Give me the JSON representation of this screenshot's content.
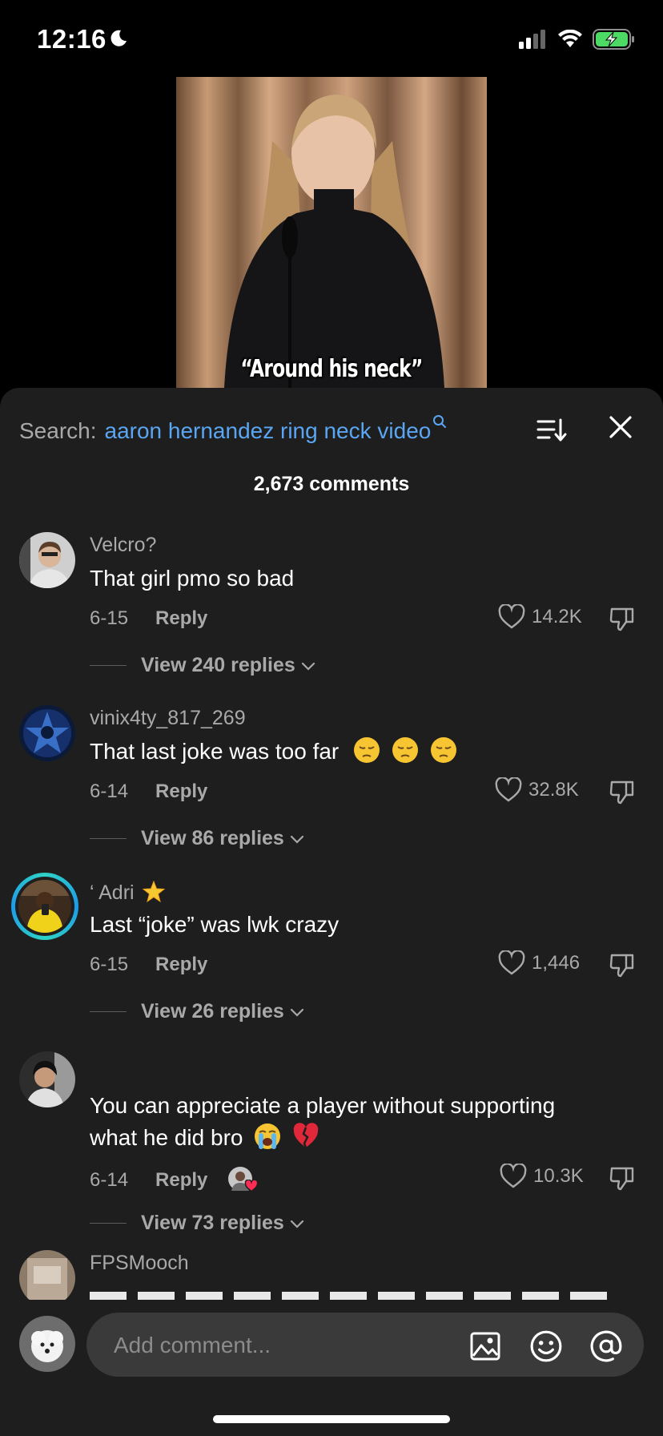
{
  "status_bar": {
    "time": "12:16",
    "battery_color": "#4cd964"
  },
  "video": {
    "caption": "“Around his neck”"
  },
  "search": {
    "label": "Search:",
    "query": "aaron hernandez ring neck video"
  },
  "comment_count": "2,673 comments",
  "comments": [
    {
      "username": "Velcro?",
      "text": "That girl pmo so bad",
      "date": "6-15",
      "reply": "Reply",
      "likes": "14.2K",
      "view_replies": "View 240 replies"
    },
    {
      "username": "vinix4ty_817_269",
      "text": "That last joke was too far",
      "date": "6-14",
      "reply": "Reply",
      "likes": "32.8K",
      "view_replies": "View 86 replies"
    },
    {
      "username": "‘ Adri",
      "text": "Last “joke” was lwk crazy",
      "date": "6-15",
      "reply": "Reply",
      "likes": "1,446",
      "view_replies": "View 26 replies"
    },
    {
      "username": "",
      "text_line1": "You can appreciate a player without supporting",
      "text_line2": "what he did bro",
      "date": "6-14",
      "reply": "Reply",
      "likes": "10.3K",
      "view_replies": "View 73 replies"
    },
    {
      "username": "FPSMooch"
    }
  ],
  "input": {
    "placeholder": "Add comment..."
  },
  "colors": {
    "accent_link": "#5aa6f3",
    "sheet_bg": "#1e1e1e",
    "muted_text": "#a9a9a9",
    "heart_red": "#ff2d55"
  }
}
